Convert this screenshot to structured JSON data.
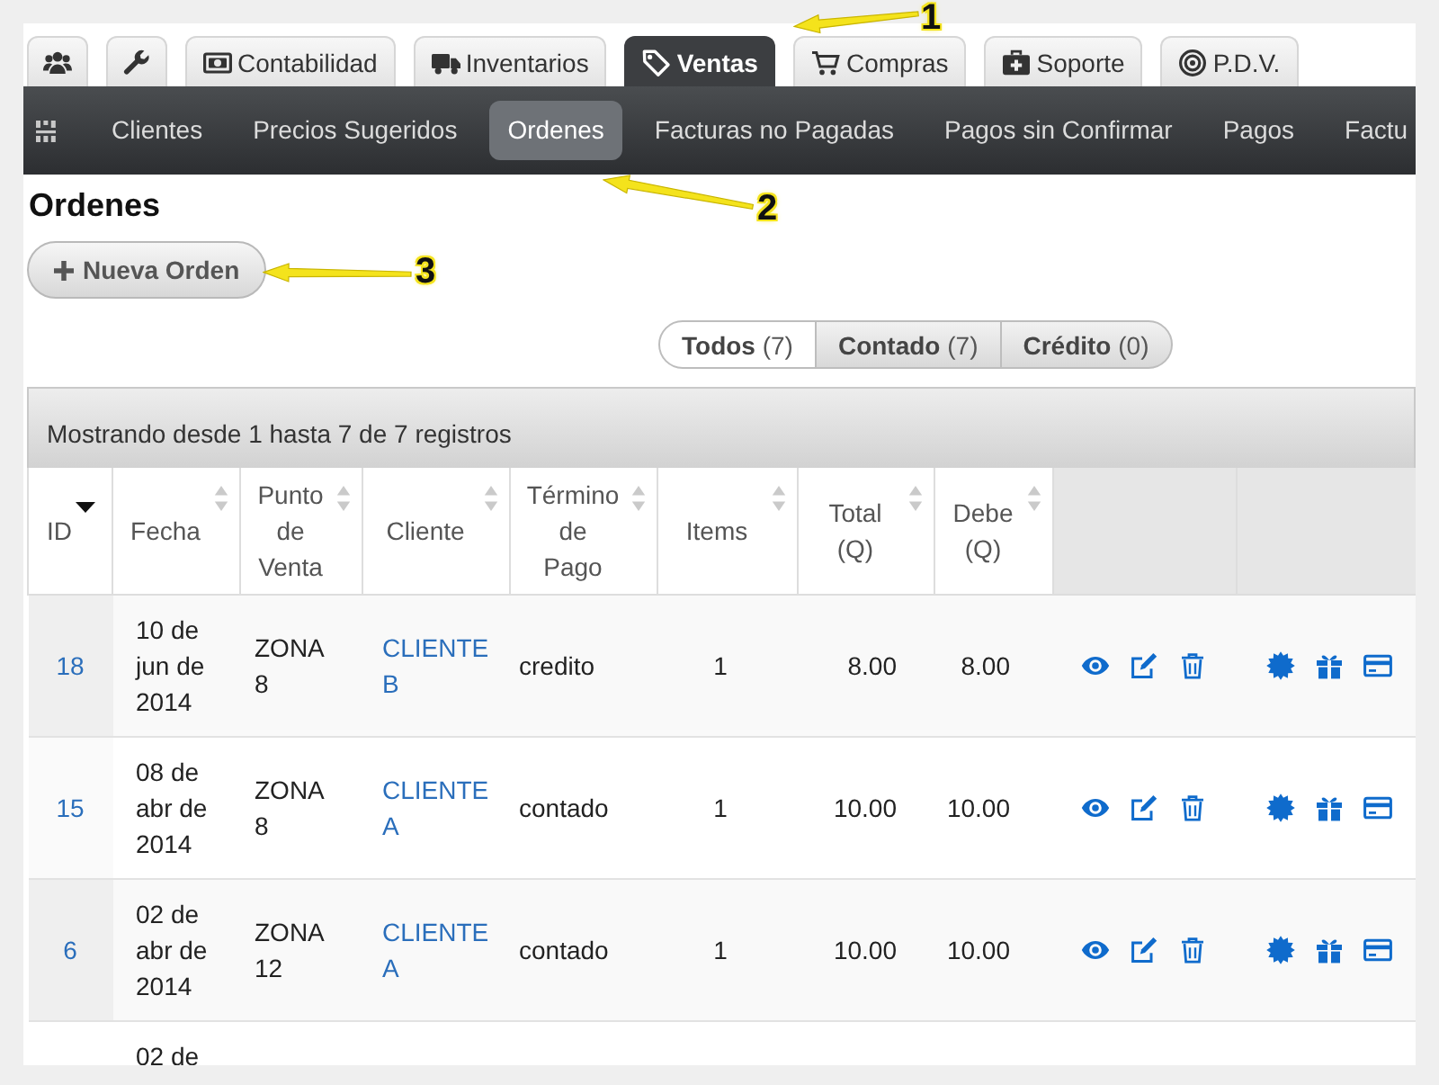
{
  "main_tabs": [
    {
      "selected": false
    },
    {
      "selected": false
    },
    {
      "label": "Contabilidad",
      "selected": false
    },
    {
      "label": "Inventarios",
      "selected": false
    },
    {
      "label": "Ventas",
      "selected": true
    },
    {
      "label": "Compras",
      "selected": false
    },
    {
      "label": "Soporte",
      "selected": false
    },
    {
      "label": "P.D.V.",
      "selected": false
    }
  ],
  "sub_nav": [
    {
      "label": "Clientes",
      "selected": false
    },
    {
      "label": "Precios Sugeridos",
      "selected": false
    },
    {
      "label": "Ordenes",
      "selected": true
    },
    {
      "label": "Facturas no Pagadas",
      "selected": false
    },
    {
      "label": "Pagos sin Confirmar",
      "selected": false
    },
    {
      "label": "Pagos",
      "selected": false
    },
    {
      "label": "Factu",
      "selected": false
    }
  ],
  "page_title": "Ordenes",
  "new_order_button": {
    "label": "Nueva Orden"
  },
  "filters": [
    {
      "label": "Todos",
      "count": "(7)",
      "selected": true
    },
    {
      "label": "Contado",
      "count": "(7)",
      "selected": false
    },
    {
      "label": "Crédito",
      "count": "(0)",
      "selected": false
    }
  ],
  "table": {
    "info": "Mostrando desde 1 hasta 7 de 7 registros",
    "columns": [
      {
        "label": "ID",
        "sorted": true
      },
      {
        "label": "Fecha",
        "sorted": false
      },
      {
        "label": "Punto de Venta",
        "sorted": false
      },
      {
        "label": "Cliente",
        "sorted": false
      },
      {
        "label": "Término de Pago",
        "sorted": false
      },
      {
        "label": "Items",
        "sorted": false
      },
      {
        "label": "Total (Q)",
        "sorted": false
      },
      {
        "label": "Debe (Q)",
        "sorted": false
      }
    ],
    "rows": [
      {
        "id": "18",
        "fecha": "10 de jun de 2014",
        "punto_de_venta": "ZONA 8",
        "cliente": "CLIENTE B",
        "termino_de_pago": "credito",
        "items": "1",
        "total": "8.00",
        "debe": "8.00",
        "actions": true
      },
      {
        "id": "15",
        "fecha": "08 de abr de 2014",
        "punto_de_venta": "ZONA 8",
        "cliente": "CLIENTE A",
        "termino_de_pago": "contado",
        "items": "1",
        "total": "10.00",
        "debe": "10.00",
        "actions": true
      },
      {
        "id": "6",
        "fecha": "02 de abr de 2014",
        "punto_de_venta": "ZONA 12",
        "cliente": "CLIENTE A",
        "termino_de_pago": "contado",
        "items": "1",
        "total": "10.00",
        "debe": "10.00",
        "actions": true
      },
      {
        "fecha": "02 de"
      }
    ]
  },
  "callouts": [
    {
      "label": "1"
    },
    {
      "label": "2"
    },
    {
      "label": "3"
    }
  ]
}
